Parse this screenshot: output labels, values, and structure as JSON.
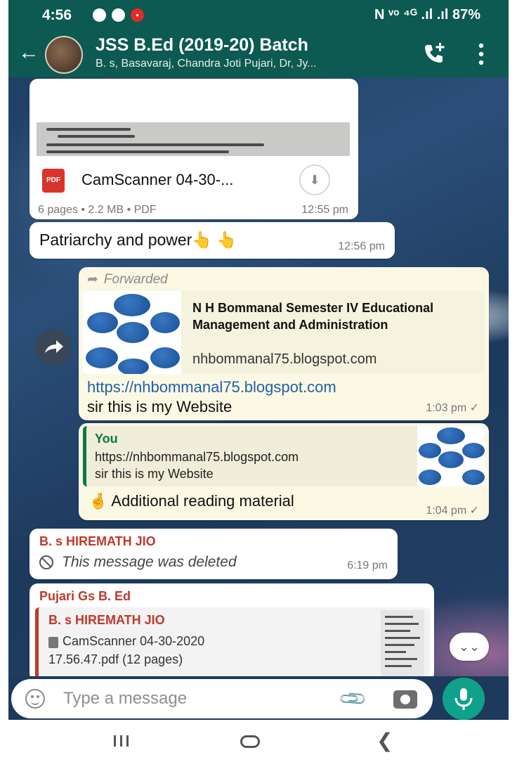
{
  "status_bar": {
    "time": "4:56",
    "battery": "87%",
    "right_icons_text": "N ᵛᵒ ⁴ᴳ .ıl .ıl 87%"
  },
  "header": {
    "title": "JSS B.Ed (2019-20) Batch",
    "subtitle": "B. s, Basavaraj, Chandra Joti Pujari, Dr, Jy...",
    "icons": [
      "back-arrow-icon",
      "add-call-icon",
      "more-vertical-icon"
    ]
  },
  "messages": {
    "doc": {
      "file_name": "CamScanner 04-30-...",
      "pdf_label": "PDF",
      "meta": "6 pages • 2.2 MB • PDF",
      "time": "12:55 pm"
    },
    "text1": {
      "text": "Patriarchy and power👆 👆",
      "time": "12:56 pm"
    },
    "forwarded": {
      "label": "Forwarded",
      "link_title": "N H Bommanal Semester IV Educational Management and Administration",
      "link_domain": "nhbommanal75.blogspot.com",
      "url": "https://nhbommanal75.blogspot.com",
      "text": "sir this is my Website",
      "time": "1:03 pm ✓"
    },
    "reply": {
      "quote_author": "You",
      "quote_url": "https://nhbommanal75.blogspot.com",
      "quote_text": "sir this is my Website",
      "text": "🤞 Additional reading material",
      "time": "1:04 pm ✓"
    },
    "deleted": {
      "sender": "B. s HIREMATH JIO",
      "text": "This message was deleted",
      "time": "6:19 pm"
    },
    "reply_doc": {
      "sender": "Pujari Gs B. Ed",
      "quote_author": "B. s HIREMATH JIO",
      "quote_line1": "CamScanner 04-30-2020",
      "quote_line2": "17.56.47.pdf (12 pages)"
    }
  },
  "input": {
    "placeholder": "Type a message"
  },
  "colors": {
    "header_green": "#0c5a51",
    "outgoing_bubble": "#fbf8e4",
    "sender_red": "#c0392b",
    "link_blue": "#2160a8",
    "mic_green": "#10a18a"
  }
}
